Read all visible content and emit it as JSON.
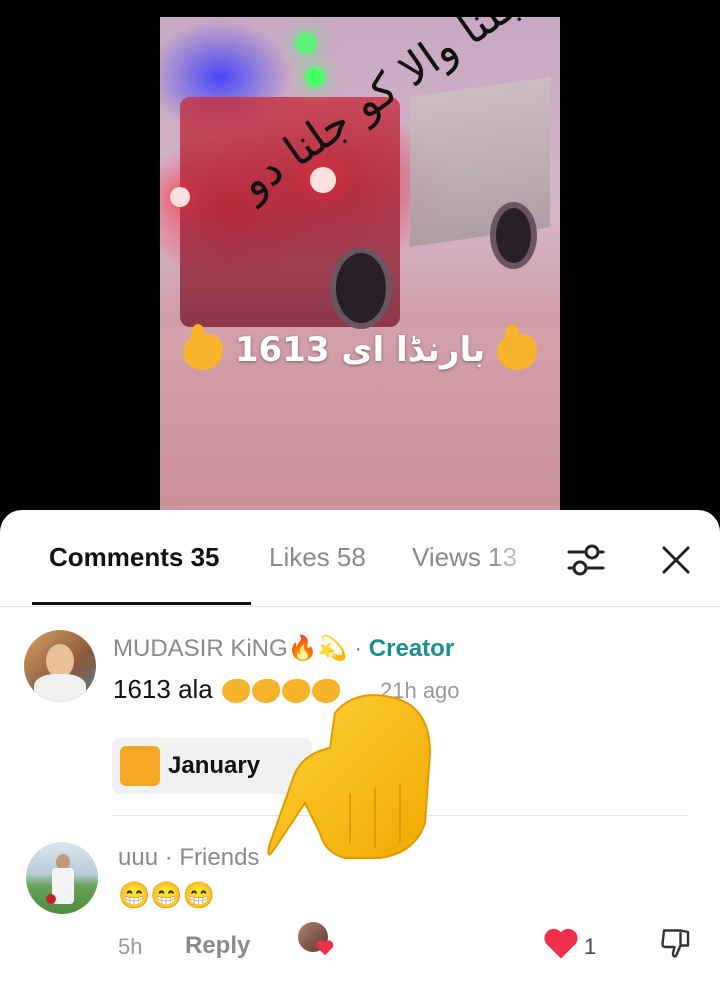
{
  "video": {
    "urdu_overlay": "جلنا والا کو جلنا دو",
    "caption_number": "1613",
    "caption_urdu": "بارنڈا ای"
  },
  "tabs": [
    {
      "label": "Comments 35",
      "active": true
    },
    {
      "label": "Likes 58",
      "active": false
    },
    {
      "label": "Views 13",
      "active": false
    }
  ],
  "icons": {
    "filter": "sliders-icon",
    "close": "close-icon"
  },
  "comments": [
    {
      "username": "MUDASIR KiNG",
      "username_suffix": "🔥💫",
      "separator": "·",
      "role": "Creator",
      "text": "1613 ala",
      "time": "21h ago",
      "pill_text": "January"
    },
    {
      "username": "uuu",
      "separator": "·",
      "relation": "Friends",
      "text": "😁😁😁",
      "time": "5h",
      "reply_label": "Reply",
      "like_count": "1"
    }
  ],
  "colors": {
    "creator": "#1a8f8f",
    "heart": "#f0304a",
    "pointer": "#f5c518"
  }
}
